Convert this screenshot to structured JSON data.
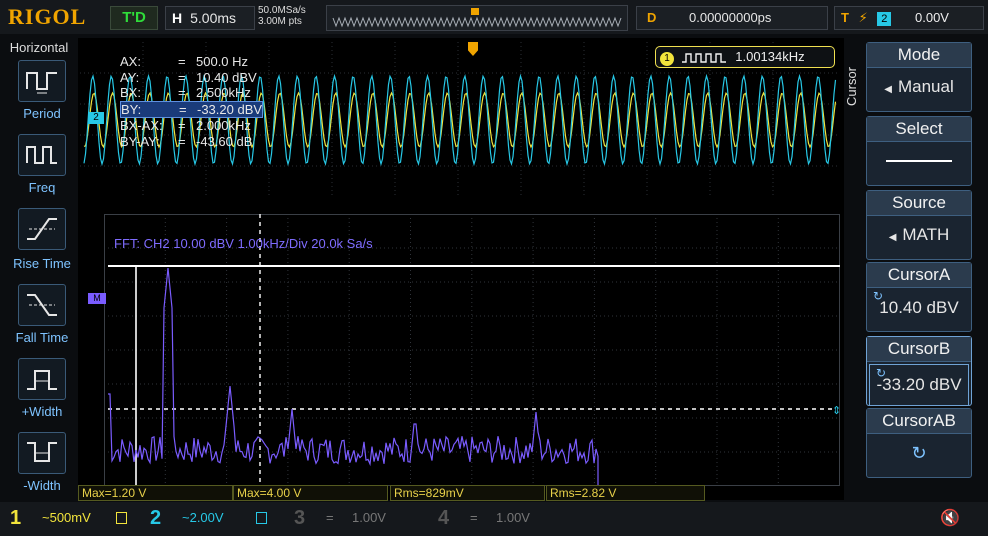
{
  "brand": "RIGOL",
  "top": {
    "run_state": "T'D",
    "h_key": "H",
    "timebase": "5.00ms",
    "sample_rate": "50.0MSa/s",
    "memory": "3.00M pts",
    "d_key": "D",
    "delay": "0.00000000ps",
    "t_key": "T",
    "trigger_channel": "2",
    "trigger_level": "0.00V"
  },
  "left_menu": {
    "title": "Horizontal",
    "items": [
      "Period",
      "Freq",
      "Rise Time",
      "Fall Time",
      "+Width",
      "-Width"
    ]
  },
  "cursor_readout": [
    {
      "key": "AX:",
      "eq": "=",
      "val": "500.0 Hz"
    },
    {
      "key": "AY:",
      "eq": "=",
      "val": "10.40 dBV"
    },
    {
      "key": "BX:",
      "eq": "=",
      "val": "2.500kHz"
    },
    {
      "key": "BY:",
      "eq": "=",
      "val": "-33.20 dBV"
    },
    {
      "key": "BX-AX:",
      "eq": "=",
      "val": "2.000kHz"
    },
    {
      "key": "BY-AY:",
      "eq": "=",
      "val": "-43.60 dB"
    }
  ],
  "freq_counter": {
    "channel": "1",
    "value": "1.00134kHz"
  },
  "fft_label": "FFT:  CH2  10.00 dBV    1.00kHz/Div    20.0k Sa/s",
  "markers": {
    "ch2": "2",
    "math": "M"
  },
  "measurements": [
    "Max=1.20 V",
    "Max=4.00 V",
    "Rms=829mV",
    "Rms=2.82 V"
  ],
  "right_menu": {
    "side_label": "Cursor",
    "mode_title": "Mode",
    "mode_value": "Manual",
    "select_title": "Select",
    "source_title": "Source",
    "source_value": "MATH",
    "cursora_title": "CursorA",
    "cursora_value": "10.40 dBV",
    "cursorb_title": "CursorB",
    "cursorb_value": "-33.20 dBV",
    "cursorab_title": "CursorAB"
  },
  "bottom": {
    "ch1": "1",
    "ch1_scale": "~500mV",
    "ch2": "2",
    "ch2_scale": "~2.00V",
    "ch3": "3",
    "ch3_scale": "1.00V",
    "ch4": "4",
    "ch4_scale": "1.00V"
  },
  "colors": {
    "ch1": "#f2e43c",
    "ch2": "#27c8e6",
    "math": "#7a5cff",
    "accent": "#f0a400"
  }
}
